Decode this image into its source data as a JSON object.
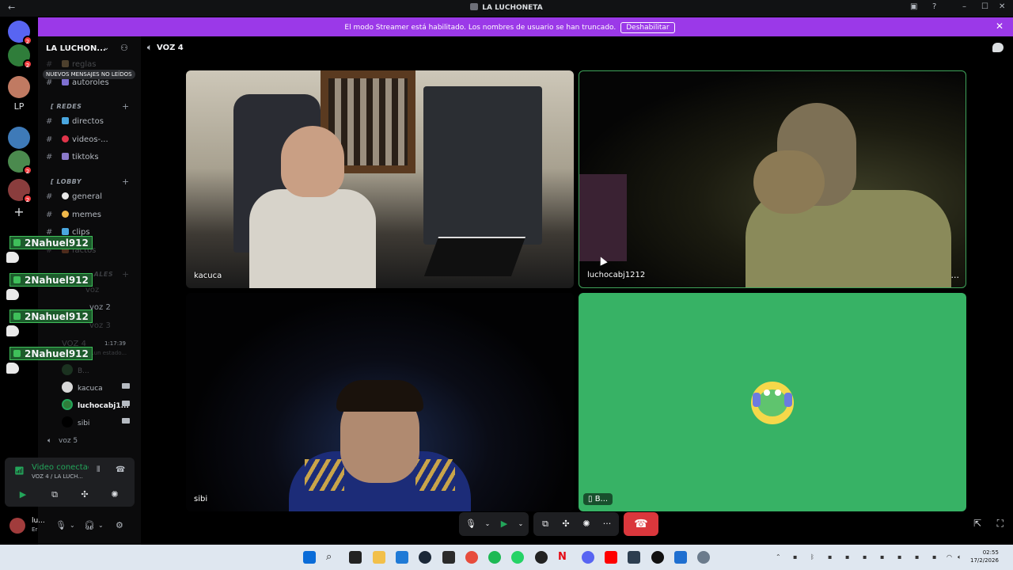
{
  "window": {
    "title": "LA LUCHONETA",
    "back_glyph": "←",
    "min_glyph": "–",
    "max_glyph": "☐",
    "close_glyph": "✕",
    "help_glyph": "?"
  },
  "banner": {
    "message": "El modo Streamer está habilitado. Los nombres de usuario se han truncado.",
    "button_label": "Deshabilitar",
    "close_glyph": "✕",
    "color": "#9b39e8"
  },
  "rail": {
    "lp_label": "LP",
    "plus_glyph": "+",
    "badges": [
      "2",
      "2",
      "2",
      "2",
      "2"
    ]
  },
  "sidebar": {
    "server_name": "LA LUCHON...",
    "unread_banner": "NUEVOS MENSAJES NO LEÍDOS",
    "channels_top": [
      {
        "hash": "#",
        "label": "reglas"
      },
      {
        "hash": "#",
        "label": "autoroles"
      }
    ],
    "category_redes": "REDES",
    "redes": [
      {
        "hash": "#",
        "label": "directos"
      },
      {
        "hash": "#",
        "label": "videos-..."
      },
      {
        "hash": "#",
        "label": "tiktoks"
      }
    ],
    "category_lobby": "LOBBY",
    "lobby": [
      {
        "hash": "#",
        "label": "general"
      },
      {
        "hash": "#",
        "label": "memes"
      },
      {
        "hash": "#",
        "label": "clips"
      },
      {
        "hash": "#",
        "label": "factos"
      }
    ],
    "category_voice": "...ALES",
    "voice_channels": [
      "voz",
      "voz 2",
      "voz 3",
      "VOZ 4"
    ],
    "timestamp": "1:17:39",
    "status_hint": "...un estado...",
    "voice_users": [
      {
        "name": "B..."
      },
      {
        "name": "kacuca"
      },
      {
        "name": "luchocabj1..."
      },
      {
        "name": "sibi"
      }
    ],
    "voice5": "voz 5",
    "plus_glyph": "+"
  },
  "overlay_chat": [
    "2Nahuel912",
    "2Nahuel912",
    "2Nahuel912",
    "2Nahuel912"
  ],
  "voice_panel": {
    "title": "Video conectad",
    "subtitle": "VOZ 4 / LA LUCH..."
  },
  "user_panel": {
    "name": "lu...",
    "status": "Er"
  },
  "main": {
    "channel": "VOZ 4",
    "tiles": [
      {
        "label": "kacuca"
      },
      {
        "label": "luchocabj1212"
      },
      {
        "label": "sibi"
      },
      {
        "label": "B..."
      }
    ],
    "more_glyph": "···",
    "hangup_glyph": "☎"
  },
  "taskbar": {
    "time": "02:55",
    "date": "17/2/2026"
  },
  "colors": {
    "green_tile": "#37b265",
    "hangup": "#da373c",
    "connected": "#23a55a"
  }
}
